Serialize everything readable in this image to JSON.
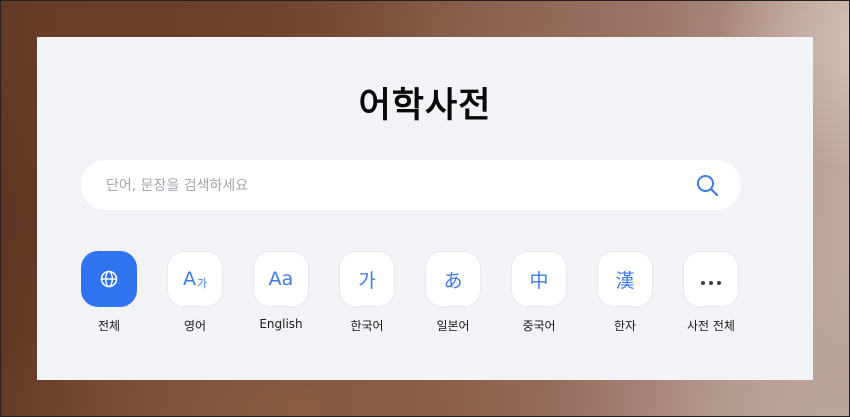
{
  "page": {
    "title": "어학사전"
  },
  "search": {
    "placeholder": "단어, 문장을 검색하세요",
    "icon": "search-icon"
  },
  "colors": {
    "panel_bg": "#f2f3f7",
    "accent": "#2f73f0",
    "icon_blue": "#3f7be6",
    "placeholder": "#a3a7ae"
  },
  "categories": [
    {
      "label": "전체",
      "icon": "globe-icon",
      "active": true
    },
    {
      "label": "영어",
      "icon": "a-ga-icon",
      "glyph_main": "A",
      "glyph_sub": "가"
    },
    {
      "label": "English",
      "icon": "aa-icon",
      "glyph": "Aa"
    },
    {
      "label": "한국어",
      "icon": "hangul-ga-icon",
      "glyph": "가"
    },
    {
      "label": "일본어",
      "icon": "hiragana-a-icon",
      "glyph": "あ"
    },
    {
      "label": "중국어",
      "icon": "hanzi-zhong-icon",
      "glyph": "中"
    },
    {
      "label": "한자",
      "icon": "hanja-han-icon",
      "glyph": "漢"
    },
    {
      "label": "사전 전체",
      "icon": "more-dots-icon"
    }
  ]
}
